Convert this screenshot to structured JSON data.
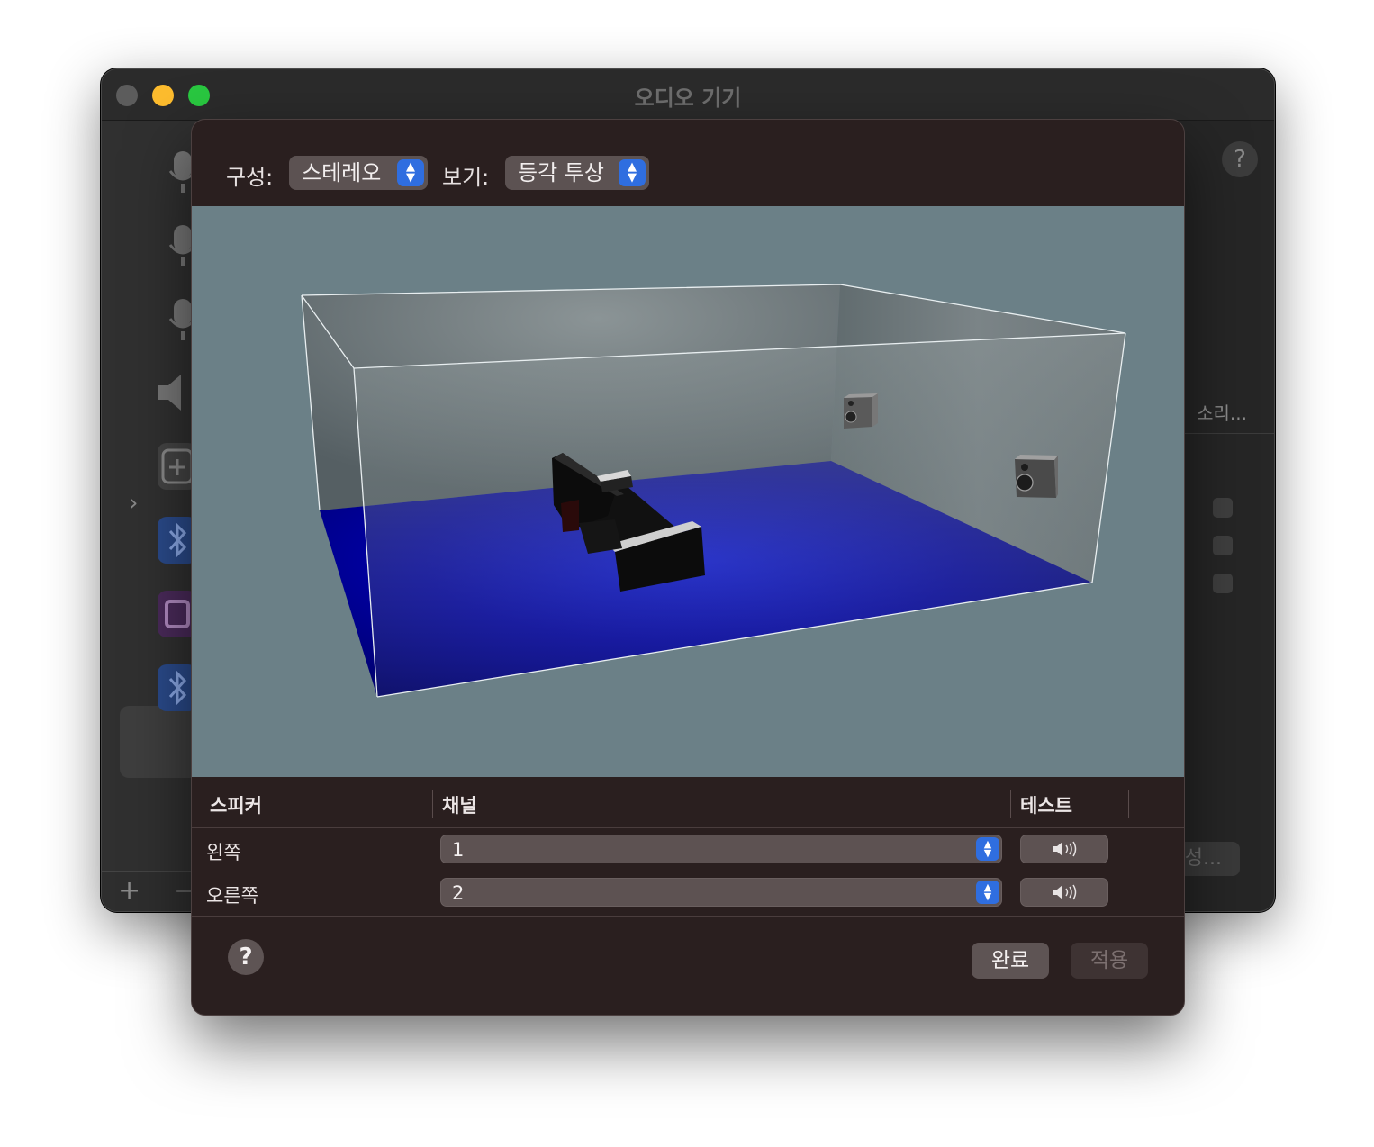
{
  "window": {
    "title": "오디오 기기"
  },
  "background": {
    "right_label": "소리...",
    "configure_button": "성...",
    "help": "?",
    "plus": "+",
    "minus": "−",
    "chevron": "›"
  },
  "toolbar": {
    "config_label": "구성:",
    "config_value": "스테레오",
    "view_label": "보기:",
    "view_value": "등각 투상"
  },
  "table": {
    "headers": {
      "speaker": "스피커",
      "channel": "채널",
      "test": "테스트"
    },
    "rows": [
      {
        "speaker": "왼쪽",
        "channel": "1"
      },
      {
        "speaker": "오른쪽",
        "channel": "2"
      }
    ]
  },
  "footer": {
    "help": "?",
    "done": "완료",
    "apply": "적용"
  },
  "icons": {
    "speaker_test": "speaker-volume-icon",
    "stepper": "up-down-stepper-icon",
    "mic": "microphone-icon",
    "bluetooth": "bluetooth-icon"
  },
  "colors": {
    "accent": "#2f6ee0",
    "floor": "#0000c8",
    "scene_bg": "#6b8087",
    "sheet_bg": "#2a1f1f"
  }
}
